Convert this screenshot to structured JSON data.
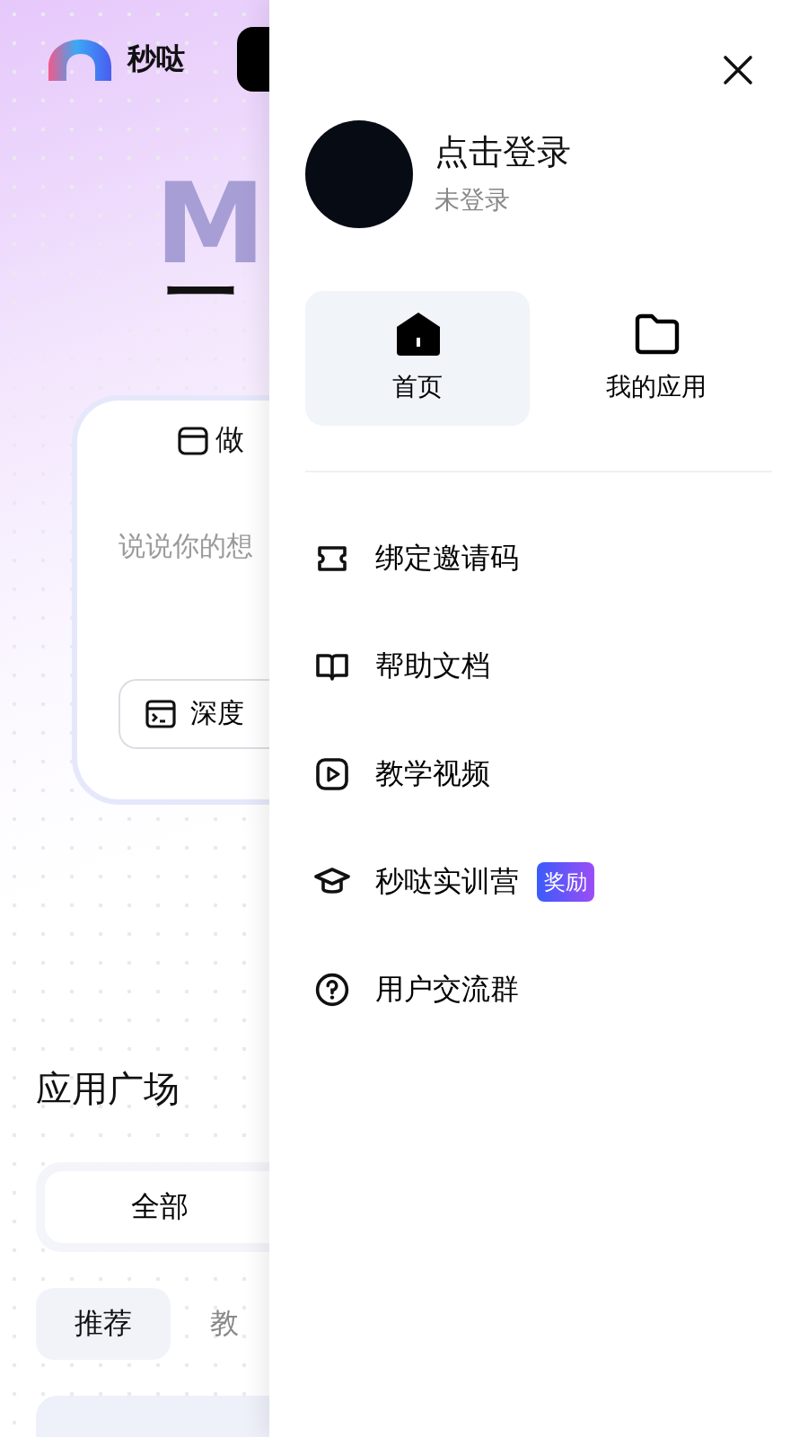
{
  "background_page": {
    "logo_text": "秒哒",
    "hero_letter": "M",
    "headline": "一",
    "card": {
      "mode_label": "做",
      "placeholder": "说说你的想",
      "depth_button": "深度"
    },
    "section_title": "应用广场",
    "segments": [
      {
        "label": "全部"
      }
    ],
    "categories": [
      {
        "label": "推荐",
        "selected": true
      },
      {
        "label": "教",
        "selected": false
      }
    ]
  },
  "drawer": {
    "user": {
      "name": "点击登录",
      "status": "未登录"
    },
    "nav": [
      {
        "label": "首页",
        "selected": true
      },
      {
        "label": "我的应用",
        "selected": false
      }
    ],
    "menu": [
      {
        "label": "绑定邀请码"
      },
      {
        "label": "帮助文档"
      },
      {
        "label": "教学视频"
      },
      {
        "label": "秒哒实训营",
        "badge": "奖励"
      },
      {
        "label": "用户交流群"
      }
    ]
  }
}
